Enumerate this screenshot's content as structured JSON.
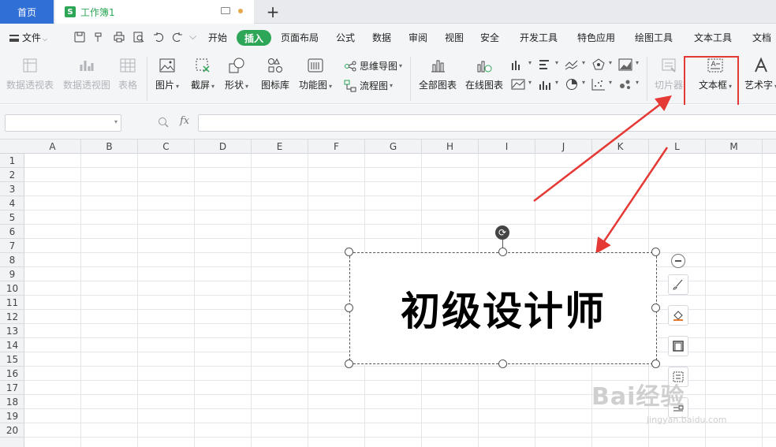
{
  "tabs": {
    "home": "首页",
    "workbook": "工作簿1",
    "workbook_icon_letter": "S",
    "add": "+"
  },
  "menu": {
    "file": "文件",
    "items": [
      "开始",
      "插入",
      "页面布局",
      "公式",
      "数据",
      "审阅",
      "视图",
      "安全",
      "开发工具",
      "特色应用",
      "绘图工具",
      "文本工具",
      "文档"
    ],
    "active": "插入"
  },
  "ribbon": {
    "pivot_table": "数据透视表",
    "pivot_chart": "数据透视图",
    "table": "表格",
    "picture": "图片",
    "screenshot": "截屏",
    "shape": "形状",
    "icon_library": "图标库",
    "function_chart": "功能图",
    "mindmap": "思维导图",
    "flowchart": "流程图",
    "all_charts": "全部图表",
    "online_chart": "在线图表",
    "slicer": "切片器",
    "textbox": "文本框",
    "wordart": "艺术字"
  },
  "formula_bar": {
    "fx": "fx",
    "name_value": "",
    "formula_value": ""
  },
  "grid": {
    "columns": [
      "A",
      "B",
      "C",
      "D",
      "E",
      "F",
      "G",
      "H",
      "I",
      "J",
      "K",
      "L",
      "M"
    ],
    "rows": [
      "1",
      "2",
      "3",
      "4",
      "5",
      "6",
      "7",
      "8",
      "9",
      "10",
      "11",
      "12",
      "13",
      "14",
      "15",
      "16",
      "17",
      "18",
      "19",
      "20"
    ]
  },
  "textbox": {
    "content": "初级设计师"
  },
  "watermark": {
    "logo": "Bai经验",
    "url": "jingyan.baidu.com"
  },
  "colors": {
    "accent_green": "#2ea658",
    "home_blue": "#2f6fd6",
    "highlight_red": "#e53935",
    "arrow_red": "#e53935"
  }
}
